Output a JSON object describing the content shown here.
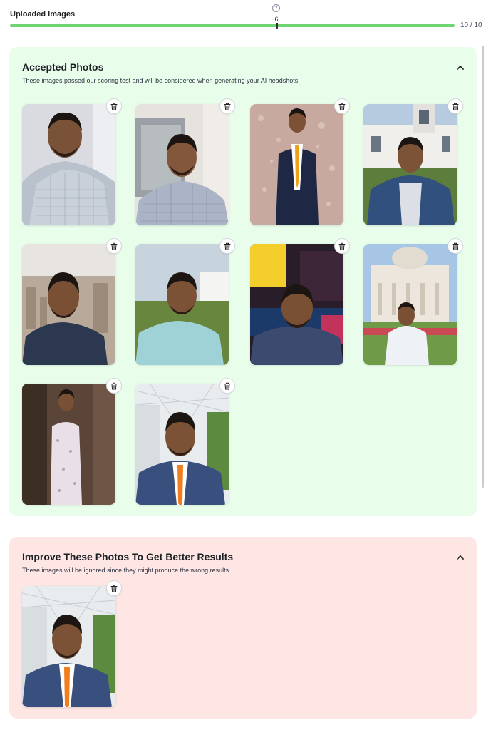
{
  "header": {
    "title": "Uploaded Images",
    "progress_marker_label": "6",
    "progress": {
      "current": 10,
      "total": 10,
      "text": "10 / 10",
      "fill_percent": 100
    },
    "help_icon": "question-circle-icon"
  },
  "accepted": {
    "title": "Accepted Photos",
    "subtitle": "These images passed our scoring test and will be considered when generating your AI headshots.",
    "collapse_icon": "chevron-up-icon",
    "color": "#e9fdeb",
    "photos": [
      {
        "name": "photo-1",
        "delete_icon": "trash-icon"
      },
      {
        "name": "photo-2",
        "delete_icon": "trash-icon"
      },
      {
        "name": "photo-3",
        "delete_icon": "trash-icon"
      },
      {
        "name": "photo-4",
        "delete_icon": "trash-icon"
      },
      {
        "name": "photo-5",
        "delete_icon": "trash-icon"
      },
      {
        "name": "photo-6",
        "delete_icon": "trash-icon"
      },
      {
        "name": "photo-7",
        "delete_icon": "trash-icon"
      },
      {
        "name": "photo-8",
        "delete_icon": "trash-icon"
      },
      {
        "name": "photo-9",
        "delete_icon": "trash-icon"
      },
      {
        "name": "photo-10",
        "delete_icon": "trash-icon"
      }
    ]
  },
  "improve": {
    "title": "Improve These Photos To Get Better Results",
    "subtitle": "These images will be ignored since they might produce the wrong results.",
    "collapse_icon": "chevron-up-icon",
    "color": "#fde6e4",
    "photos": [
      {
        "name": "photo-11",
        "delete_icon": "trash-icon"
      }
    ]
  },
  "colors": {
    "progress": "#6fd472",
    "accent_border": "#d4d7dc"
  }
}
